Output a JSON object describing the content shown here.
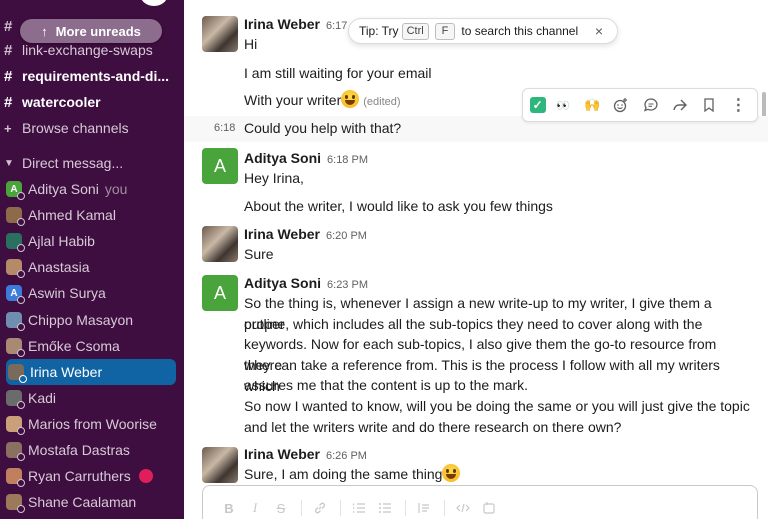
{
  "sidebar": {
    "more_unreads": "More unreads",
    "channels": [
      {
        "label": "link-exchange-swaps",
        "bold": false
      },
      {
        "label": "requirements-and-di...",
        "bold": true
      },
      {
        "label": "watercooler",
        "bold": true
      }
    ],
    "browse_channels": "Browse channels",
    "dm_header": "Direct messag...",
    "you_tag": "you",
    "dms": [
      {
        "label": "Aditya Soni",
        "initial": "A",
        "color": "#4aa43c"
      },
      {
        "label": "Ahmed Kamal",
        "initial": "",
        "color": "#8c6a4a"
      },
      {
        "label": "Ajlal Habib",
        "initial": "",
        "color": "#2a6f5f"
      },
      {
        "label": "Anastasia",
        "initial": "",
        "color": "#b58a68"
      },
      {
        "label": "Aswin Surya",
        "initial": "A",
        "color": "#3d7bd9"
      },
      {
        "label": "Chippo Masayon",
        "initial": "",
        "color": "#6f8fb0"
      },
      {
        "label": "Emőke Csoma",
        "initial": "",
        "color": "#a88a74"
      },
      {
        "label": "Irina Weber",
        "initial": "",
        "color": "#7a6a5c"
      },
      {
        "label": "Kadi",
        "initial": "",
        "color": "#6b6b6b"
      },
      {
        "label": "Marios from Woorise",
        "initial": "",
        "color": "#c9a07a"
      },
      {
        "label": "Mostafa Dastras",
        "initial": "",
        "color": "#8a7060"
      },
      {
        "label": "Ryan Carruthers",
        "initial": "",
        "color": "#c08060"
      },
      {
        "label": "Shane Caalaman",
        "initial": "",
        "color": "#9a7a5a"
      }
    ]
  },
  "tip": {
    "prefix": "Tip: Try",
    "key1": "Ctrl",
    "key2": "F",
    "suffix": "to search this channel",
    "close": "×"
  },
  "messages": [
    {
      "name": "Irina Weber",
      "time": "6:17",
      "lines": [
        "Hi",
        "I am still waiting for your email",
        "With your writer"
      ],
      "edited": "(edited)"
    },
    {
      "hover_time": "6:18",
      "text": "Could you help with that?"
    },
    {
      "name": "Aditya Soni",
      "initial": "A",
      "time": "6:18 PM",
      "lines": [
        "Hey Irina,",
        "About the writer, I would like to ask you few things"
      ]
    },
    {
      "name": "Irina Weber",
      "time": "6:20 PM",
      "lines": [
        "Sure"
      ]
    },
    {
      "name": "Aditya Soni",
      "initial": "A",
      "time": "6:23 PM",
      "lines": [
        "So the thing is, whenever I assign a new write-up to my writer, I give them a proper",
        "outline, which includes all the sub-topics they need to cover along with the",
        "keywords. Now for each sub-topics, I also give them the go-to resource from where",
        "they can take a reference from.  This is the process I follow with all my writers which",
        "assures me that the content is up to the mark.",
        "So now I wanted to know, will you be doing the same or you will just give the topic",
        "and let the writers write and do there research on there own?"
      ]
    },
    {
      "name": "Irina Weber",
      "time": "6:26 PM",
      "lines": [
        "Sure, I am doing the same thing"
      ]
    }
  ],
  "actions": [
    "check-reaction-icon",
    "eyes-reaction-icon",
    "raised-hands-reaction-icon",
    "add-reaction-icon",
    "reply-in-thread-icon",
    "share-icon",
    "bookmark-icon",
    "more-actions-icon"
  ],
  "composer_tools": [
    "B",
    "I",
    "S"
  ]
}
